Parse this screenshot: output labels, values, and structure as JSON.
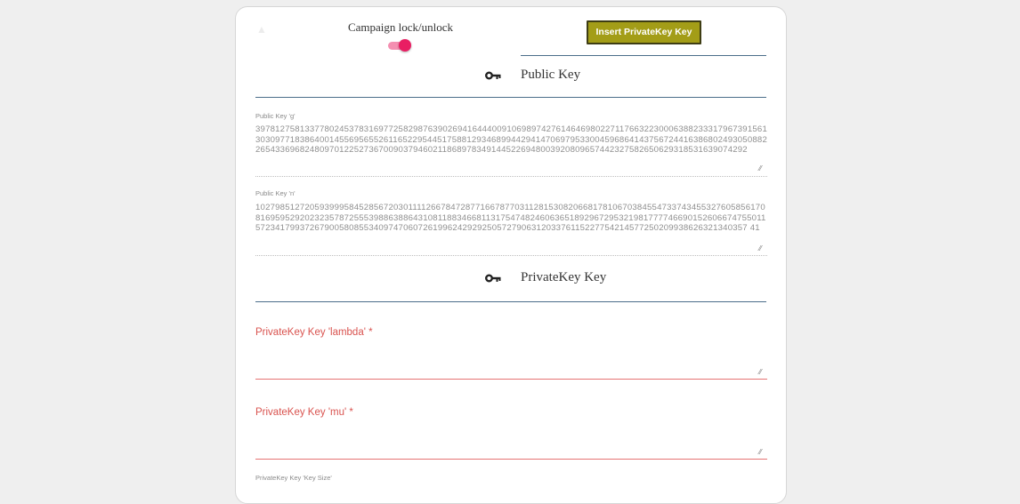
{
  "campaign": {
    "lock_label": "Campaign lock/unlock",
    "lock_enabled": true,
    "toggle_color": "#e91e63"
  },
  "actions": {
    "insert_button_label": "Insert PrivateKey Key",
    "insert_button_color": "#a39d17"
  },
  "public_key": {
    "section_title": "Public Key",
    "section_icon": "key-icon",
    "g_label": "Public Key 'g'",
    "g_value": "39781275813377802453783169772582987639026941644400910698974276146469802271176632230006388233317967391561303097718386400145569565526116522954451758812934689944294147069795330045968641437567244163868024930508822654336968248097012252736700903794602118689783491445226948003920809657442327582650629318531639074292",
    "n_label": "Public Key 'n'",
    "n_value": "10279851272059399958452856720301111266784728771667877031128153082066817810670384554733743455327605856170816959529202323578725553988638864310811883466811317547482460636518929672953219817777466901526066747550115723417993726790058085534097470607261996242929250572790631203376115227754214577250209938626321340357 41"
  },
  "private_key": {
    "section_title": "PrivateKey Key",
    "section_icon": "key-icon",
    "lambda_label": "PrivateKey Key 'lambda' *",
    "lambda_value": "",
    "mu_label": "PrivateKey Key 'mu' *",
    "mu_value": "",
    "key_size_label": "PrivateKey Key 'Key Size'"
  },
  "colors": {
    "divider": "#4b6d8a",
    "required_label": "#d9534f",
    "required_underline": "#e57373"
  }
}
